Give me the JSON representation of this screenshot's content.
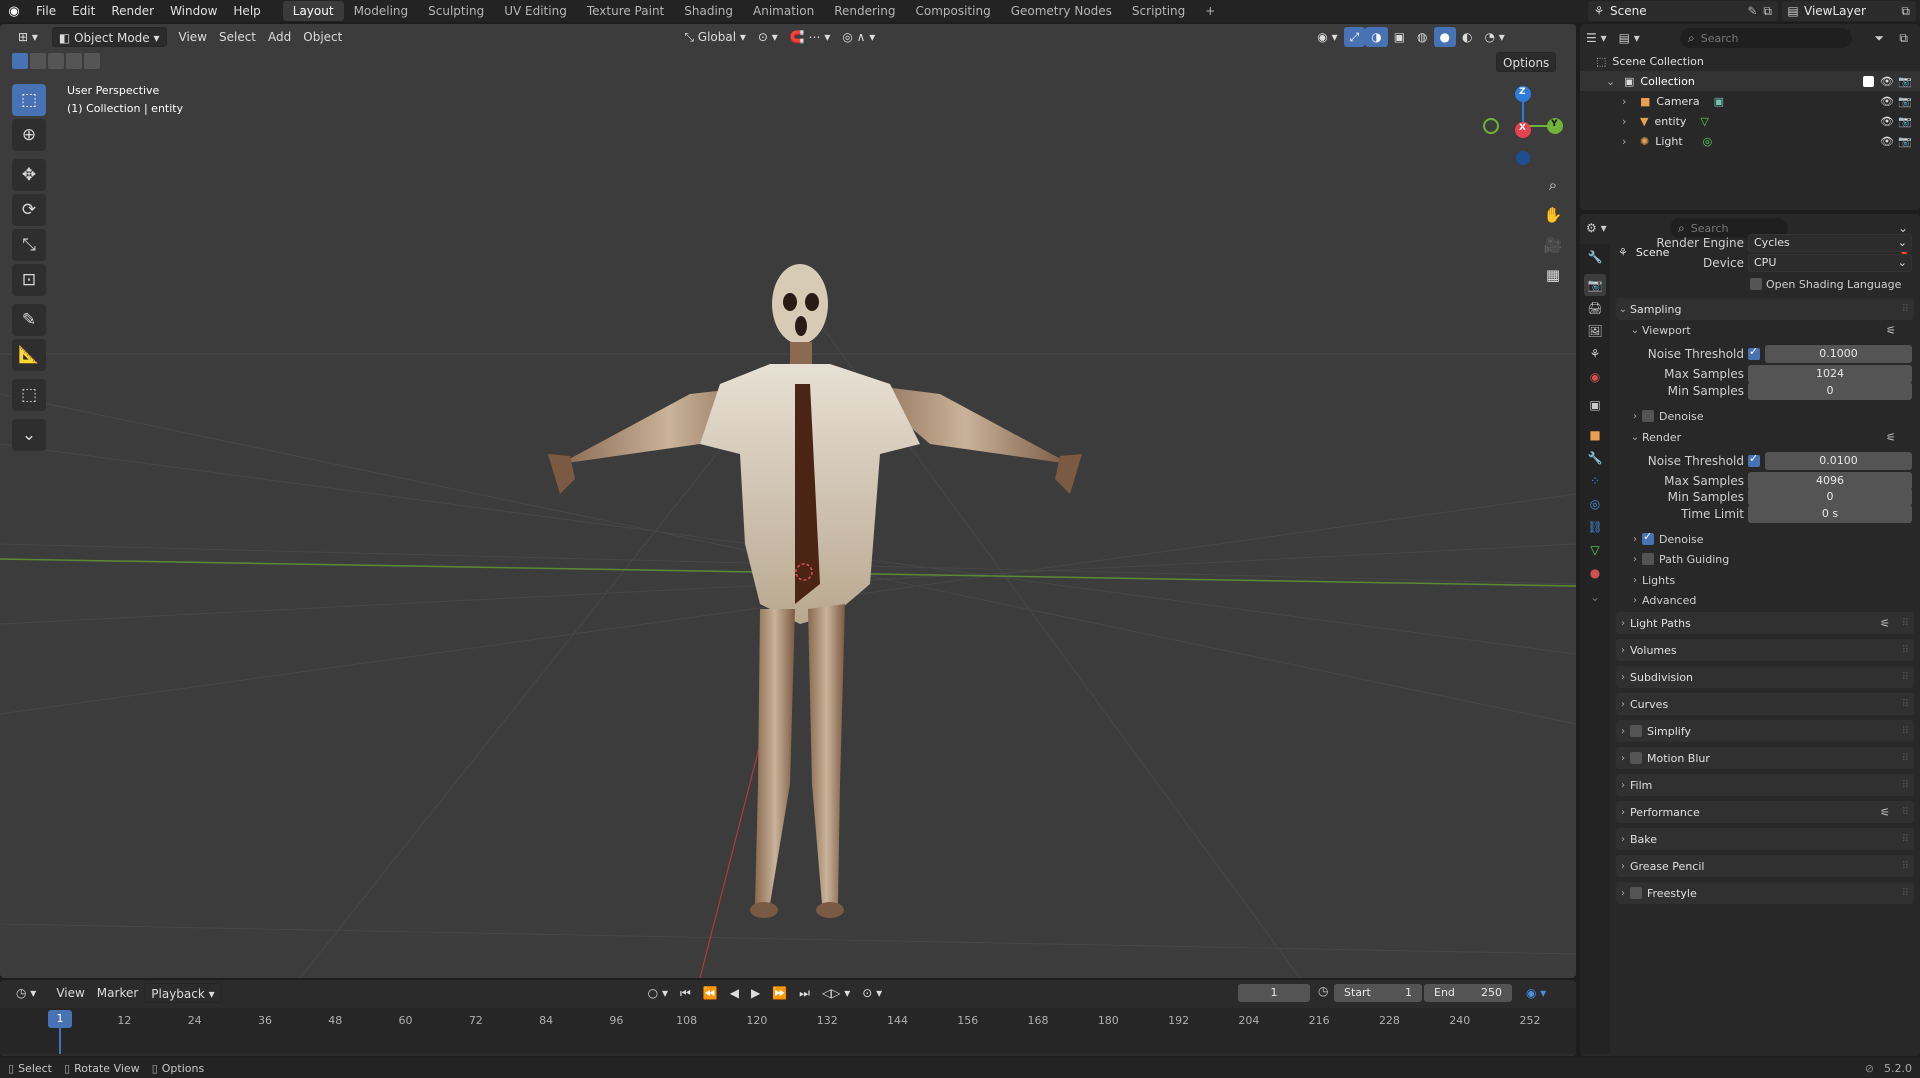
{
  "menu": {
    "items": [
      "File",
      "Edit",
      "Render",
      "Window",
      "Help"
    ],
    "workspaces": [
      "Layout",
      "Modeling",
      "Sculpting",
      "UV Editing",
      "Texture Paint",
      "Shading",
      "Animation",
      "Rendering",
      "Compositing",
      "Geometry Nodes",
      "Scripting"
    ],
    "active_workspace": "Layout",
    "add_tab": "+",
    "scene": "Scene",
    "view_layer": "ViewLayer"
  },
  "viewport": {
    "mode": "Object Mode",
    "menus": [
      "View",
      "Select",
      "Add",
      "Object"
    ],
    "orientation": "Global",
    "options": "Options",
    "perspective": "User Perspective",
    "collection_info": "(1) Collection | entity",
    "gizmo": {
      "x": "X",
      "y": "Y",
      "z": "Z"
    }
  },
  "timeline": {
    "menus": [
      "View",
      "Marker",
      "Playback"
    ],
    "current_frame": "1",
    "start_label": "Start",
    "start": "1",
    "end_label": "End",
    "end": "250",
    "ticks": [
      "1",
      "12",
      "24",
      "36",
      "48",
      "60",
      "72",
      "84",
      "96",
      "108",
      "120",
      "132",
      "144",
      "156",
      "168",
      "180",
      "192",
      "204",
      "216",
      "228",
      "240",
      "252"
    ]
  },
  "status": {
    "select": "Select",
    "rotate": "Rotate View",
    "options": "Options",
    "version": "5.2.0"
  },
  "outliner": {
    "search_placeholder": "Search",
    "root": "Scene Collection",
    "collection": "Collection",
    "objects": [
      "Camera",
      "entity",
      "Light"
    ]
  },
  "properties": {
    "search_placeholder": "Search",
    "context": "Scene",
    "render_engine_label": "Render Engine",
    "render_engine": "Cycles",
    "device_label": "Device",
    "device": "CPU",
    "osl_label": "Open Shading Language",
    "sampling": "Sampling",
    "viewport_section": "Viewport",
    "render_section": "Render",
    "noise_threshold_label": "Noise Threshold",
    "max_samples_label": "Max Samples",
    "min_samples_label": "Min Samples",
    "time_limit_label": "Time Limit",
    "viewport_noise_threshold": "0.1000",
    "viewport_max_samples": "1024",
    "viewport_min_samples": "0",
    "render_noise_threshold": "0.0100",
    "render_max_samples": "4096",
    "render_min_samples": "0",
    "render_time_limit": "0 s",
    "denoise_label": "Denoise",
    "path_guiding_label": "Path Guiding",
    "lights_label": "Lights",
    "advanced_label": "Advanced",
    "panels": [
      "Light Paths",
      "Volumes",
      "Subdivision",
      "Curves",
      "Simplify",
      "Motion Blur",
      "Film",
      "Performance",
      "Bake",
      "Grease Pencil",
      "Freestyle"
    ]
  },
  "colors": {
    "accent": "#4772b3",
    "x_axis": "#e64150",
    "y_axis": "#6fb33a",
    "z_axis": "#2f7bdc"
  }
}
